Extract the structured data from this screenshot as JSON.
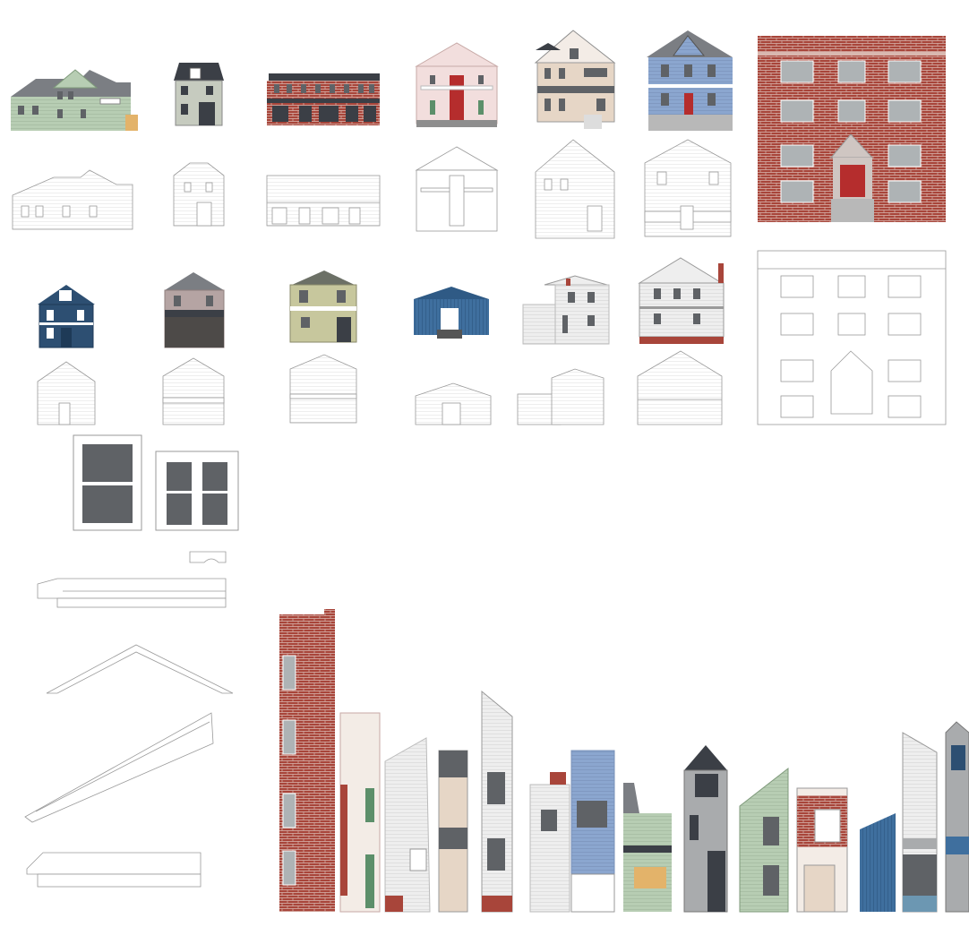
{
  "page": {
    "background": "#ffffff"
  },
  "palette": {
    "line": "#9a9a9a",
    "brick": "#a8453a",
    "brick_dark": "#8e3329",
    "mortar": "#d9b8b0",
    "sage": "#b7cdb3",
    "slate_blue": "#8ba6cf",
    "navy": "#2d4f72",
    "taupe": "#b5a4a3",
    "olive": "#c7c79d",
    "steel_blue": "#3f6f9e",
    "grey_roof": "#7b7e83",
    "dark_roof": "#3b3f46",
    "window": "#5f6266",
    "cream": "#f3ece6",
    "pink": "#f2dedd",
    "door_red": "#b52d2d",
    "green": "#5c8f6a",
    "white": "#ffffff"
  },
  "icons": {
    "window_single": "double-hung-window-icon",
    "window_double": "double-casement-window-icon",
    "cornice": "cornice-profile-icon",
    "pediment": "pediment-icon",
    "rake": "rake-trim-icon",
    "sill": "sill-profile-icon"
  }
}
